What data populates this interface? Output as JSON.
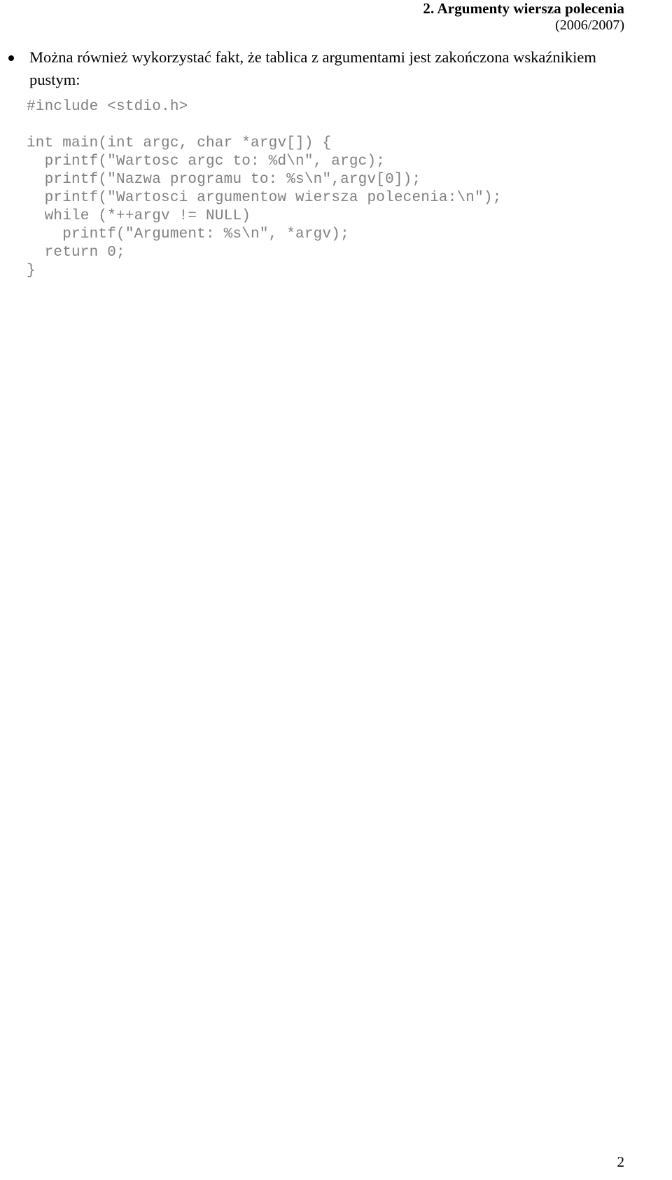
{
  "header": {
    "title": "2. Argumenty wiersza polecenia",
    "subtitle": "(2006/2007)"
  },
  "body": {
    "bullet": {
      "marker": "bullet-dot",
      "text": "Można również wykorzystać fakt, że tablica z argumentami jest zakończona wskaźnikiem pustym:"
    },
    "code": {
      "language": "c",
      "color": "#808080",
      "lines": [
        "#include <stdio.h>",
        "",
        "int main(int argc, char *argv[]) {",
        "  printf(\"Wartosc argc to: %d\\n\", argc);",
        "  printf(\"Nazwa programu to: %s\\n\",argv[0]);",
        "  printf(\"Wartosci argumentow wiersza polecenia:\\n\");",
        "  while (*++argv != NULL)",
        "    printf(\"Argument: %s\\n\", *argv);",
        "  return 0;",
        "}"
      ]
    }
  },
  "footer": {
    "page_number": "2"
  }
}
